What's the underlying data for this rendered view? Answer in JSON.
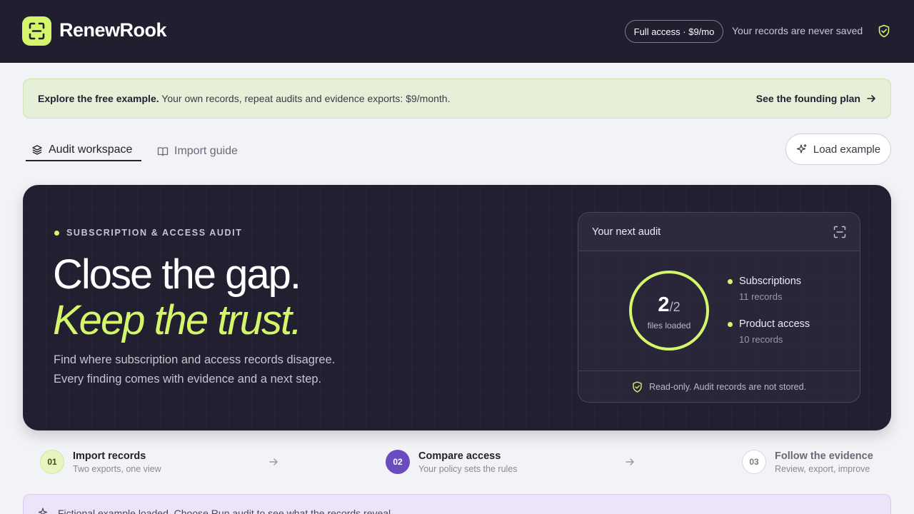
{
  "header": {
    "brand": "RenewRook",
    "access_pill": "Full access · $9/mo",
    "never_saved": "Your records are never saved"
  },
  "banner": {
    "bold": "Explore the free example.",
    "text": " Your own records, repeat audits and evidence exports: $9/month.",
    "link": "See the founding plan"
  },
  "tabs": [
    {
      "label": "Audit workspace",
      "active": true
    },
    {
      "label": "Import guide",
      "active": false
    }
  ],
  "load_example": "Load example",
  "hero": {
    "eyebrow": "SUBSCRIPTION & ACCESS AUDIT",
    "line1": "Close the gap.",
    "line2": "Keep the trust.",
    "desc1": "Find where subscription and access records disagree.",
    "desc2": "Every finding comes with evidence and a next step."
  },
  "card": {
    "title": "Your next audit",
    "loaded": "2",
    "total": "/2",
    "loaded_label": "files loaded",
    "stats": [
      {
        "name": "Subscriptions",
        "count": "11 records"
      },
      {
        "name": "Product access",
        "count": "10 records"
      }
    ],
    "footer": "Read-only. Audit records are not stored."
  },
  "steps": [
    {
      "num": "01",
      "title": "Import records",
      "sub": "Two exports, one view"
    },
    {
      "num": "02",
      "title": "Compare access",
      "sub": "Your policy sets the rules"
    },
    {
      "num": "03",
      "title": "Follow the evidence",
      "sub": "Review, export, improve"
    }
  ],
  "notice": "Fictional example loaded. Choose Run audit to see what the records reveal.",
  "colors": {
    "accent": "#d4f66a",
    "dark": "#211e30",
    "purple": "#6a4cc0"
  }
}
